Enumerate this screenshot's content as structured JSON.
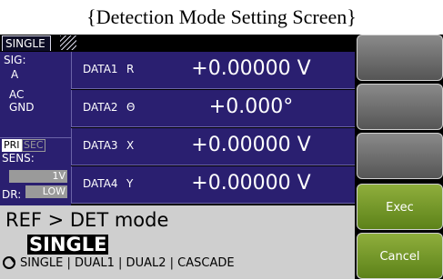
{
  "caption": "{Detection Mode Setting Screen}",
  "tab": {
    "label": "SINGLE"
  },
  "signal": {
    "title": "SIG:",
    "input": "A",
    "coupling": "AC",
    "ground": "GND"
  },
  "sens": {
    "pri_label": "PRI",
    "sec_label": "SEC",
    "title": "SENS:",
    "value": "1V",
    "dr_label": "DR:",
    "dr_value": "LOW"
  },
  "data_rows": [
    {
      "label": "DATA1",
      "symbol": "R",
      "value": "+0.00000  V"
    },
    {
      "label": "DATA2",
      "symbol": "Θ",
      "value": "+0.000°"
    },
    {
      "label": "DATA3",
      "symbol": "X",
      "value": "+0.00000  V"
    },
    {
      "label": "DATA4",
      "symbol": "Y",
      "value": "+0.00000  V"
    }
  ],
  "ref": {
    "title": "REF > DET mode",
    "selected": "SINGLE",
    "options_line": "SINGLE | DUAL1 | DUAL2 | CASCADE"
  },
  "buttons": {
    "exec": "Exec",
    "cancel": "Cancel"
  },
  "colors": {
    "panel": "#2a1f70",
    "button_green": "#7a9a2a",
    "ref_bg": "#cfcfcf"
  }
}
